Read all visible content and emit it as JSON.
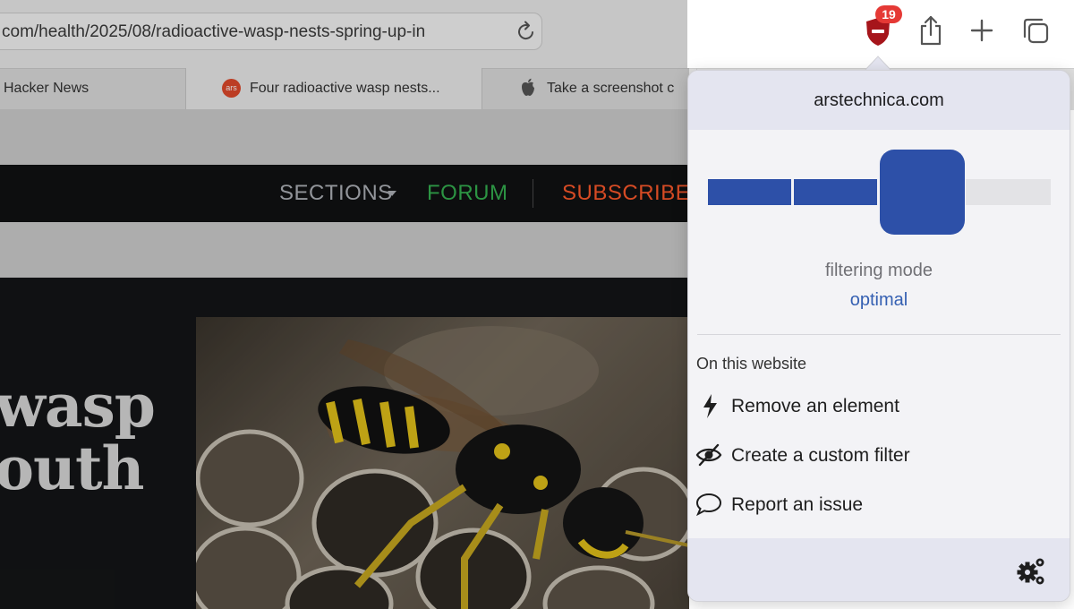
{
  "browser": {
    "url": "com/health/2025/08/radioactive-wasp-nests-spring-up-in",
    "tabs": [
      {
        "label": "Hacker News"
      },
      {
        "label": "Four radioactive wasp nests...",
        "favicon_text": "ars"
      },
      {
        "label": "Take a screenshot c"
      }
    ],
    "extension_badge_count": "19",
    "icons": [
      "reload-icon",
      "ublock-origin-icon",
      "share-icon",
      "new-tab-plus-icon",
      "show-tabs-icon",
      "apple-icon"
    ]
  },
  "page": {
    "nav": {
      "sections_label": "SECTIONS",
      "forum_label": "FORUM",
      "subscribe_label": "SUBSCRIBE"
    },
    "headline_fragment": "wasp\nouth",
    "colors": {
      "forum": "#35b150",
      "subscribe": "#ff5a2c",
      "nav_background": "#101113"
    }
  },
  "popup": {
    "hostname": "arstechnica.com",
    "filtering_mode_label": "filtering mode",
    "filtering_mode_value": "optimal",
    "filtering_mode_level": 3,
    "filtering_mode_levels_total": 4,
    "section_title": "On this website",
    "actions": [
      {
        "label": "Remove an element",
        "icon": "lightning-bolt-icon"
      },
      {
        "label": "Create a custom filter",
        "icon": "eye-slash-icon"
      },
      {
        "label": "Report an issue",
        "icon": "speech-bubble-icon"
      }
    ],
    "settings_icon": "gears-icon",
    "colors": {
      "accent": "#2d50a8",
      "mode_value": "#3560b2",
      "badge": "#e53935"
    }
  }
}
